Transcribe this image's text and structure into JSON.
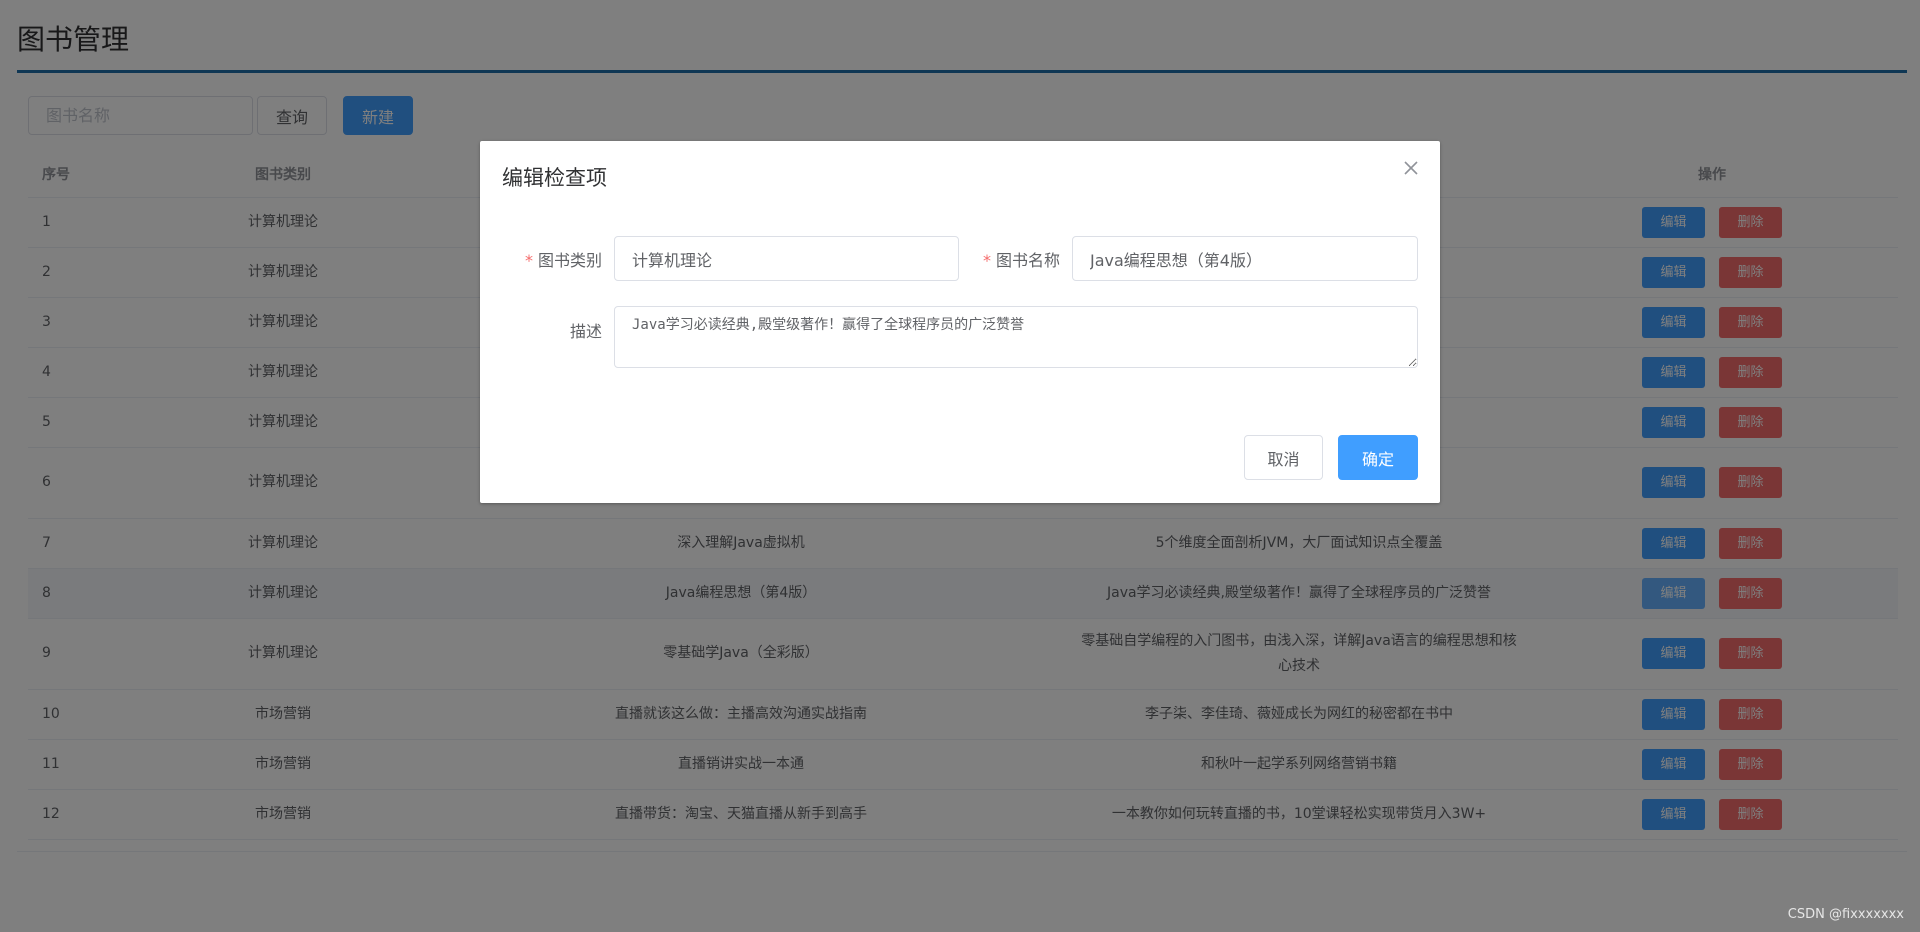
{
  "page": {
    "title": "图书管理"
  },
  "toolbar": {
    "search_placeholder": "图书名称",
    "query_label": "查询",
    "new_label": "新建"
  },
  "table": {
    "headers": {
      "index": "序号",
      "category": "图书类别",
      "name": "",
      "description": "",
      "ops": "操作"
    },
    "edit_label": "编辑",
    "delete_label": "删除",
    "rows": [
      {
        "index": "1",
        "category": "计算机理论",
        "name": "",
        "description": ""
      },
      {
        "index": "2",
        "category": "计算机理论",
        "name": "",
        "description": ""
      },
      {
        "index": "3",
        "category": "计算机理论",
        "name": "",
        "description": ""
      },
      {
        "index": "4",
        "category": "计算机理论",
        "name": "",
        "description": ""
      },
      {
        "index": "5",
        "category": "计算机理论",
        "name": "",
        "description": ""
      },
      {
        "index": "6",
        "category": "计算机理论",
        "name": "",
        "description": ""
      },
      {
        "index": "7",
        "category": "计算机理论",
        "name": "深入理解Java虚拟机",
        "description": "5个维度全面剖析JVM，大厂面试知识点全覆盖"
      },
      {
        "index": "8",
        "category": "计算机理论",
        "name": "Java编程思想（第4版）",
        "description": "Java学习必读经典,殿堂级著作！赢得了全球程序员的广泛赞誉"
      },
      {
        "index": "9",
        "category": "计算机理论",
        "name": "零基础学Java（全彩版）",
        "description": "零基础自学编程的入门图书，由浅入深，详解Java语言的编程思想和核心技术"
      },
      {
        "index": "10",
        "category": "市场营销",
        "name": "直播就该这么做：主播高效沟通实战指南",
        "description": "李子柒、李佳琦、薇娅成长为网红的秘密都在书中"
      },
      {
        "index": "11",
        "category": "市场营销",
        "name": "直播销讲实战一本通",
        "description": "和秋叶一起学系列网络营销书籍"
      },
      {
        "index": "12",
        "category": "市场营销",
        "name": "直播带货：淘宝、天猫直播从新手到高手",
        "description": "一本教你如何玩转直播的书，10堂课轻松实现带货月入3W+"
      }
    ]
  },
  "dialog": {
    "title": "编辑检查项",
    "category_label": "图书类别",
    "category_value": "计算机理论",
    "name_label": "图书名称",
    "name_value": "Java编程思想（第4版）",
    "desc_label": "描述",
    "desc_value": "Java学习必读经典,殿堂级著作！赢得了全球程序员的广泛赞誉",
    "cancel_label": "取消",
    "ok_label": "确定"
  },
  "watermark": "CSDN @fixxxxxxx",
  "colors": {
    "primary": "#409eff",
    "danger": "#f56c6c",
    "title_rule": "#1f6fa8"
  }
}
